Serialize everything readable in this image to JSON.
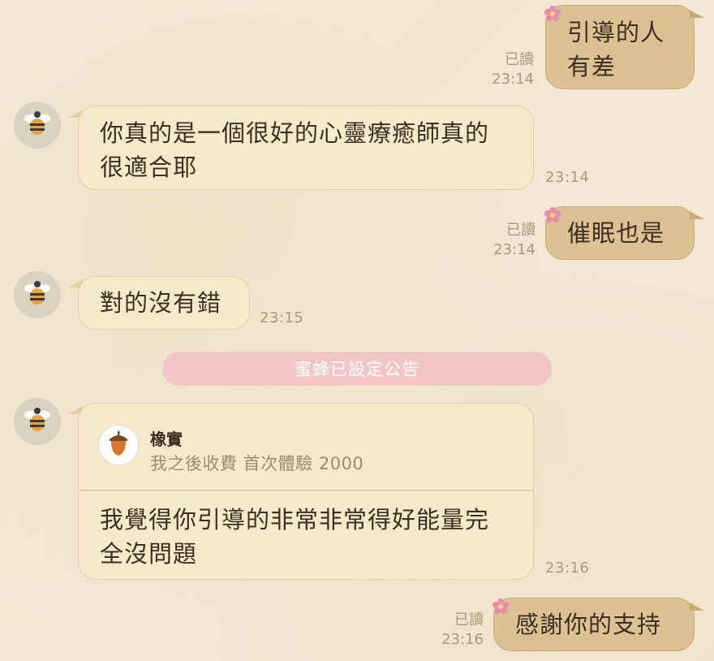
{
  "messages": [
    {
      "id": "m1",
      "direction": "out",
      "text": "引導的人\n有差",
      "read_label": "已讀",
      "time": "23:14"
    },
    {
      "id": "m2",
      "direction": "in",
      "text": "你真的是一個很好的心靈療癒師真的\n很適合耶",
      "time": "23:14"
    },
    {
      "id": "m3",
      "direction": "out",
      "text": "催眠也是",
      "read_label": "已讀",
      "time": "23:14"
    },
    {
      "id": "m4",
      "direction": "in",
      "text": "對的沒有錯",
      "time": "23:15"
    },
    {
      "id": "m5",
      "direction": "in",
      "text": "我覺得你引導的非常非常得好能量完\n全沒問題",
      "time": "23:16",
      "reply_to": {
        "name": "橡實",
        "text": "我之後收費 首次體驗 2000"
      }
    },
    {
      "id": "m6",
      "direction": "out",
      "text": "感謝你的支持",
      "read_label": "已讀",
      "time": "23:16"
    }
  ],
  "announcement": {
    "text": "蜜蜂已設定公告"
  },
  "icons": {
    "sender_avatar": "bee-icon",
    "quote_avatar": "acorn-icon",
    "out_decoration": "flower-icon"
  },
  "colors": {
    "incoming_bubble": "#f6e9cc",
    "outgoing_bubble": "#dcc193",
    "announcement": "#f2c6c6"
  }
}
